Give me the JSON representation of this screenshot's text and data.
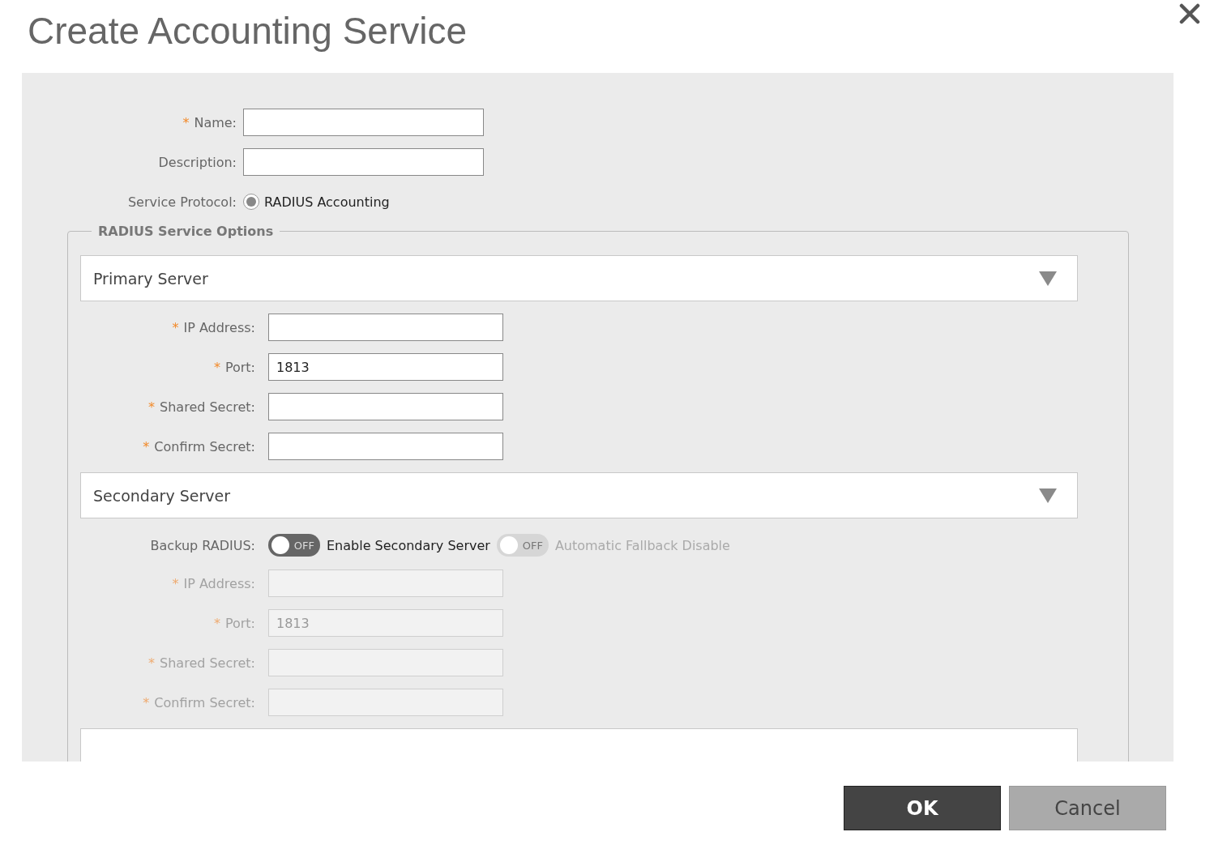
{
  "dialog": {
    "title": "Create Accounting Service"
  },
  "fields": [
    {
      "required_mark": "*",
      "label": "Name:",
      "disabled": false
    },
    {
      "label": "Description:",
      "disabled": false
    }
  ],
  "service_protocol": {
    "label": "Service Protocol:",
    "options": [
      {
        "label": "RADIUS Accounting",
        "selected": true
      }
    ]
  },
  "options_group": {
    "legend": "RADIUS Service Options",
    "sections": [
      {
        "title": "Primary Server",
        "fields": [
          {
            "required_mark": "*",
            "label": "IP Address:",
            "disabled": false
          },
          {
            "required_mark": "*",
            "label": "Port:",
            "value": "1813",
            "disabled": false
          },
          {
            "required_mark": "*",
            "label": "Shared Secret:",
            "disabled": false
          },
          {
            "required_mark": "*",
            "label": "Confirm Secret:",
            "disabled": false
          }
        ]
      },
      {
        "title": "Secondary Server",
        "backup": {
          "label": "Backup RADIUS:",
          "toggles": [
            {
              "state_text": "OFF",
              "on": false,
              "disabled": false,
              "label": "Enable Secondary Server"
            },
            {
              "state_text": "OFF",
              "on": false,
              "disabled": true,
              "label": "Automatic Fallback Disable"
            }
          ]
        },
        "fields": [
          {
            "required_mark": "*",
            "label": "IP Address:",
            "disabled": true
          },
          {
            "required_mark": "*",
            "label": "Port:",
            "value": "1813",
            "disabled": true
          },
          {
            "required_mark": "*",
            "label": "Shared Secret:",
            "disabled": true
          },
          {
            "required_mark": "*",
            "label": "Confirm Secret:",
            "disabled": true
          }
        ]
      }
    ]
  },
  "buttons": [
    {
      "label": "OK",
      "kind": "primary"
    },
    {
      "label": "Cancel",
      "kind": "secondary"
    }
  ]
}
